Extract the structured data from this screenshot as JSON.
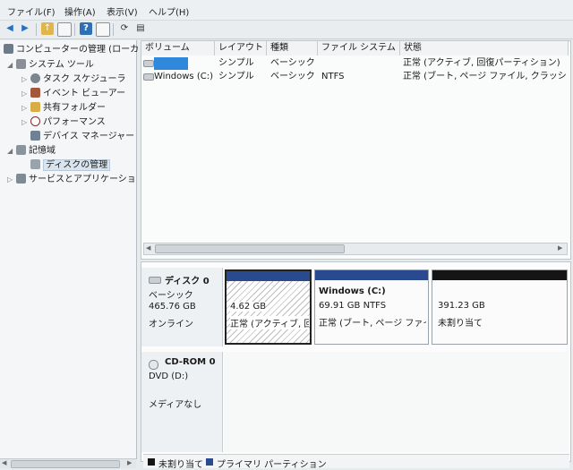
{
  "menu": [
    "ファイル(F)",
    "操作(A)",
    "表示(V)",
    "ヘルプ(H)"
  ],
  "tree": {
    "root": "コンピューターの管理 (ローカ",
    "system_tools": "システム ツール",
    "task_scheduler": "タスク スケジューラ",
    "event_viewer": "イベント ビューアー",
    "shared_folders": "共有フォルダー",
    "performance": "パフォーマンス",
    "device_manager": "デバイス マネージャー",
    "storage": "記憶域",
    "disk_management": "ディスクの管理",
    "services_apps": "サービスとアプリケーショ"
  },
  "volumes": {
    "headers": [
      "ボリューム",
      "レイアウト",
      "種類",
      "ファイル システム",
      "状態"
    ],
    "rows": [
      {
        "volume": "",
        "layout": "シンプル",
        "type": "ベーシック",
        "fs": "",
        "status": "正常 (アクティブ, 回復パーティション)"
      },
      {
        "volume": "Windows (C:)",
        "layout": "シンプル",
        "type": "ベーシック",
        "fs": "NTFS",
        "status": "正常 (ブート, ページ ファイル, クラッシュ"
      }
    ]
  },
  "disk0": {
    "name": "ディスク 0",
    "kind": "ベーシック",
    "size": "465.76 GB",
    "state": "オンライン",
    "partitions": [
      {
        "title": "",
        "size": "4.62 GB",
        "status": "正常 (アクティブ, 回"
      },
      {
        "title": "Windows (C:)",
        "size": "69.91 GB NTFS",
        "status": "正常 (ブート, ページ ファイ"
      },
      {
        "title": "",
        "size": "391.23 GB",
        "status": "未割り当て"
      }
    ]
  },
  "cdrom": {
    "name": "CD-ROM 0",
    "drive": "DVD (D:)",
    "media": "メディアなし"
  },
  "legend": {
    "unallocated": "未割り当て",
    "primary": "プライマリ パーティション"
  },
  "colors": {
    "primary": "#2a4a8f",
    "unallocated": "#151515",
    "selection": "#2f88dc"
  }
}
